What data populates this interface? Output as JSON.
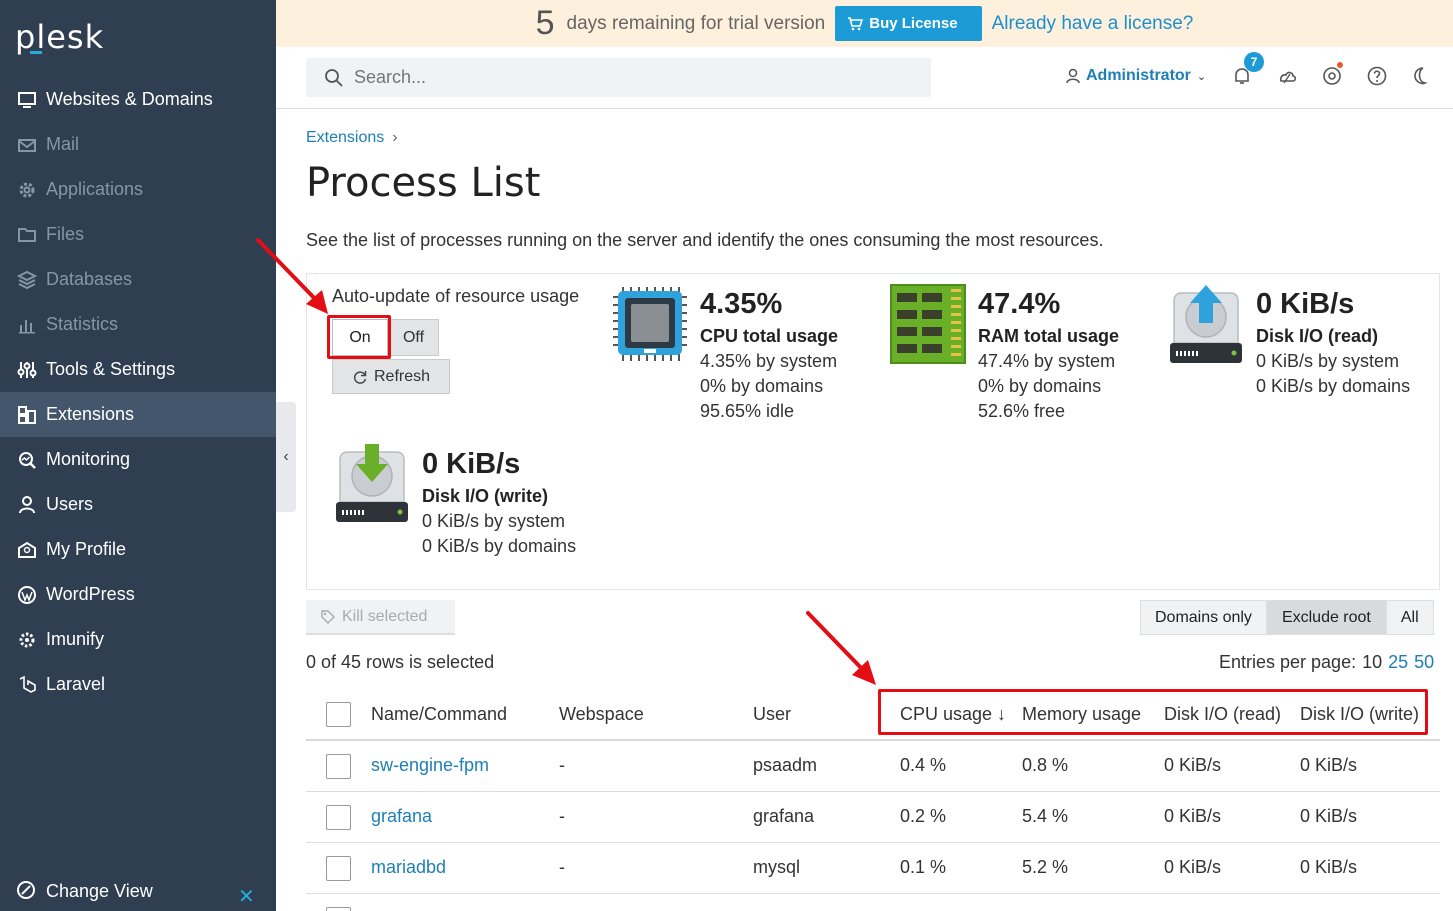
{
  "brand": {
    "logo": "plesk"
  },
  "sidebar": {
    "items": [
      {
        "label": "Websites & Domains",
        "icon": "monitor-icon",
        "state": "normal"
      },
      {
        "label": "Mail",
        "icon": "mail-icon",
        "state": "dim"
      },
      {
        "label": "Applications",
        "icon": "gear-icon",
        "state": "dim"
      },
      {
        "label": "Files",
        "icon": "folder-icon",
        "state": "dim"
      },
      {
        "label": "Databases",
        "icon": "database-icon",
        "state": "dim"
      },
      {
        "label": "Statistics",
        "icon": "bar-chart-icon",
        "state": "dim"
      },
      {
        "label": "Tools & Settings",
        "icon": "tools-icon",
        "state": "normal"
      },
      {
        "label": "Extensions",
        "icon": "extensions-icon",
        "state": "active"
      },
      {
        "label": "Monitoring",
        "icon": "monitoring-icon",
        "state": "normal"
      },
      {
        "label": "Users",
        "icon": "user-icon",
        "state": "normal"
      },
      {
        "label": "My Profile",
        "icon": "profile-icon",
        "state": "normal"
      },
      {
        "label": "WordPress",
        "icon": "wordpress-icon",
        "state": "normal"
      },
      {
        "label": "Imunify",
        "icon": "imunify-icon",
        "state": "normal"
      },
      {
        "label": "Laravel",
        "icon": "laravel-icon",
        "state": "normal"
      }
    ],
    "change_view": "Change View"
  },
  "trial": {
    "days": "5",
    "text": "days remaining for trial version",
    "buy_label": "Buy License",
    "license_link": "Already have a license?"
  },
  "header": {
    "search_placeholder": "Search...",
    "user": "Administrator",
    "notifications_count": "7"
  },
  "breadcrumb": {
    "item": "Extensions"
  },
  "page": {
    "title": "Process List",
    "description": "See the list of processes running on the server and identify the ones consuming the most resources."
  },
  "autoupdate": {
    "label": "Auto-update of resource usage",
    "on": "On",
    "off": "Off",
    "refresh": "Refresh"
  },
  "stats": {
    "cpu": {
      "value": "4.35%",
      "name": "CPU total usage",
      "lines": [
        "4.35% by system",
        "0% by domains",
        "95.65% idle"
      ]
    },
    "ram": {
      "value": "47.4%",
      "name": "RAM total usage",
      "lines": [
        "47.4% by system",
        "0% by domains",
        "52.6% free"
      ]
    },
    "disk_read": {
      "value": "0 KiB/s",
      "name": "Disk I/O (read)",
      "lines": [
        "0 KiB/s by system",
        "0 KiB/s by domains"
      ]
    },
    "disk_write": {
      "value": "0 KiB/s",
      "name": "Disk I/O (write)",
      "lines": [
        "0 KiB/s by system",
        "0 KiB/s by domains"
      ]
    }
  },
  "toolbar": {
    "kill": "Kill selected",
    "filters": [
      "Domains only",
      "Exclude root",
      "All"
    ],
    "active_filter": "Exclude root",
    "selected": "0 of 45 rows is selected",
    "per_page_label": "Entries per page:",
    "per_page": [
      "10",
      "25",
      "50"
    ]
  },
  "table": {
    "headers": [
      "Name/Command",
      "Webspace",
      "User",
      "CPU usage ↓",
      "Memory usage",
      "Disk I/O (read)",
      "Disk I/O (write)"
    ],
    "rows": [
      [
        "sw-engine-fpm",
        "-",
        "psaadm",
        "0.4 %",
        "0.8 %",
        "0 KiB/s",
        "0 KiB/s"
      ],
      [
        "grafana",
        "-",
        "grafana",
        "0.2 %",
        "5.4 %",
        "0 KiB/s",
        "0 KiB/s"
      ],
      [
        "mariadbd",
        "-",
        "mysql",
        "0.1 %",
        "5.2 %",
        "0 KiB/s",
        "0 KiB/s"
      ]
    ]
  },
  "colors": {
    "sidebar_bg": "#2f3e51",
    "accent": "#1d9bd7",
    "link": "#1d7fb5",
    "annotation_red": "#e30d14",
    "trial_bg": "#fdf0dc"
  }
}
